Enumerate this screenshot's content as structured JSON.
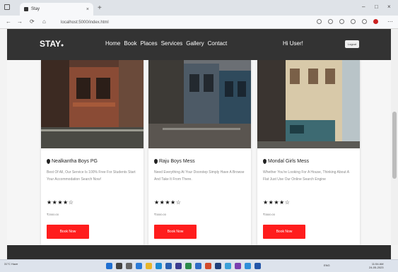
{
  "browser": {
    "tab_title": "Stay",
    "tab_close": "×",
    "new_tab": "+",
    "url": "localhost:5000/index.html",
    "back": "←",
    "forward": "→",
    "reload": "⟳",
    "home": "⌂",
    "minimize": "–",
    "maximize": "□",
    "close": "×"
  },
  "site": {
    "logo": "STAY",
    "logo_mark": "●",
    "nav": [
      "Home",
      "Book",
      "Places",
      "Services",
      "Gallery",
      "Contact"
    ],
    "greeting": "Hi User!",
    "logout": "Logout"
  },
  "cards": [
    {
      "title": "Nealkantha Boys PG",
      "desc": "Best Of All, Our Service Is 100% Free For Students Start Your Accommodation Search Now!",
      "stars": "★★★★☆",
      "rating": 4,
      "price": "₹2000.00",
      "button": "Book Now"
    },
    {
      "title": "Raju Boys Mess",
      "desc": "Need Everything At Your Doorstep Simply Have A Browse And Take It From There.",
      "stars": "★★★★☆",
      "rating": 4,
      "price": "₹3000.00",
      "button": "Book Now"
    },
    {
      "title": "Mondal Girls Mess",
      "desc": "Whether You're Looking For A House, Thinking About A Flat Just Use Our Online Search Engine",
      "stars": "★★★★☆",
      "rating": 4,
      "price": "₹3500.00",
      "button": "Book Now"
    }
  ],
  "taskbar": {
    "weather": "31°C Haze",
    "tray": "ENG",
    "time": "11:54 AM",
    "date": "24-05-2023"
  },
  "colors": {
    "navbar": "#333333",
    "button": "#ff1d1d",
    "footer": "#2e2e2e"
  }
}
